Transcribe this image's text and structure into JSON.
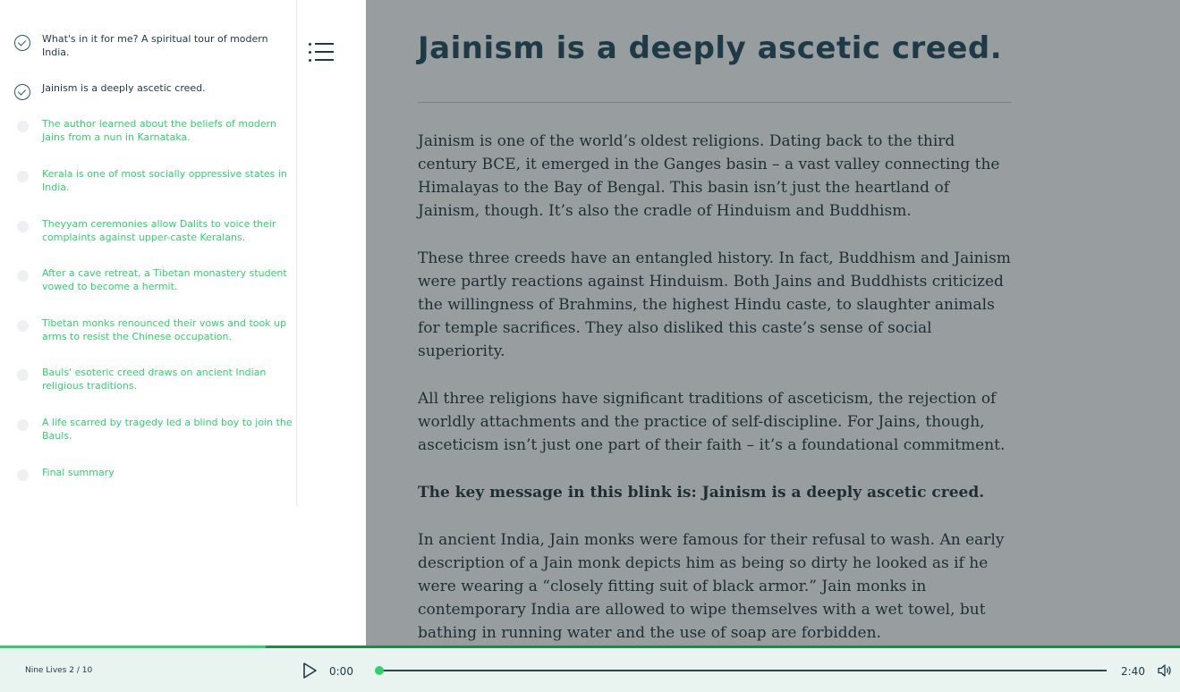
{
  "toc": {
    "items": [
      {
        "label": "What's in it for me? A spiritual tour of modern India.",
        "status": "done"
      },
      {
        "label": "Jainism is a deeply ascetic creed.",
        "status": "done"
      },
      {
        "label": "The author learned about the beliefs of modern Jains from a nun in Karnataka.",
        "status": "pending"
      },
      {
        "label": "Kerala is one of most socially oppressive states in India.",
        "status": "pending"
      },
      {
        "label": "Theyyam ceremonies allow Dalits to voice their complaints against upper-caste Keralans.",
        "status": "pending"
      },
      {
        "label": "After a cave retreat, a Tibetan monastery student vowed to become a hermit.",
        "status": "pending"
      },
      {
        "label": "Tibetan monks renounced their vows and took up arms to resist the Chinese occupation.",
        "status": "pending"
      },
      {
        "label": "Bauls' esoteric creed draws on ancient Indian religious traditions.",
        "status": "pending"
      },
      {
        "label": "A life scarred by tragedy led a blind boy to join the Bauls.",
        "status": "pending"
      },
      {
        "label": "Final summary",
        "status": "pending"
      }
    ],
    "toggle_icon": "list-icon"
  },
  "chapter": {
    "title": "Jainism is a deeply ascetic creed.",
    "paragraphs": [
      "Jainism is one of the world’s oldest religions. Dating back to the third century BCE, it emerged in the Ganges basin – a vast valley connecting the Himalayas to the Bay of Bengal. This basin isn’t just the heartland of Jainism, though. It’s also the cradle of Hinduism and Buddhism.",
      "These three creeds have an entangled history. In fact, Buddhism and Jainism were partly reactions against Hinduism. Both Jains and Buddhists criticized the willingness of Brahmins, the highest Hindu caste, to slaughter animals for temple sacrifices. They also disliked this caste’s sense of social superiority.",
      "All three religions have significant traditions of asceticism, the rejection of worldly attachments and the practice of self-discipline. For Jains, though, asceticism isn’t just one part of their faith – it’s a foundational commitment.",
      "The key message in this blink is: Jainism is a deeply ascetic creed.",
      "In ancient India, Jain monks were famous for their refusal to wash. An early description of a Jain monk depicts him as being so dirty he looked as if he were wearing a “closely fitting suit of black armor.” Jain monks in contemporary India are allowed to wipe themselves with a wet towel, but bathing in running water and the use of soap are forbidden."
    ]
  },
  "player": {
    "book_label": "Nine Lives 2 / 10",
    "current_time": "0:00",
    "total_time": "2:40",
    "audio_progress": 0.0,
    "reading_progress": 0.225,
    "play_icon": "play-icon",
    "volume_icon": "volume-icon"
  },
  "colors": {
    "accent": "#2fd16f",
    "dark": "#1d3a47",
    "content_bg": "#989e9f"
  }
}
